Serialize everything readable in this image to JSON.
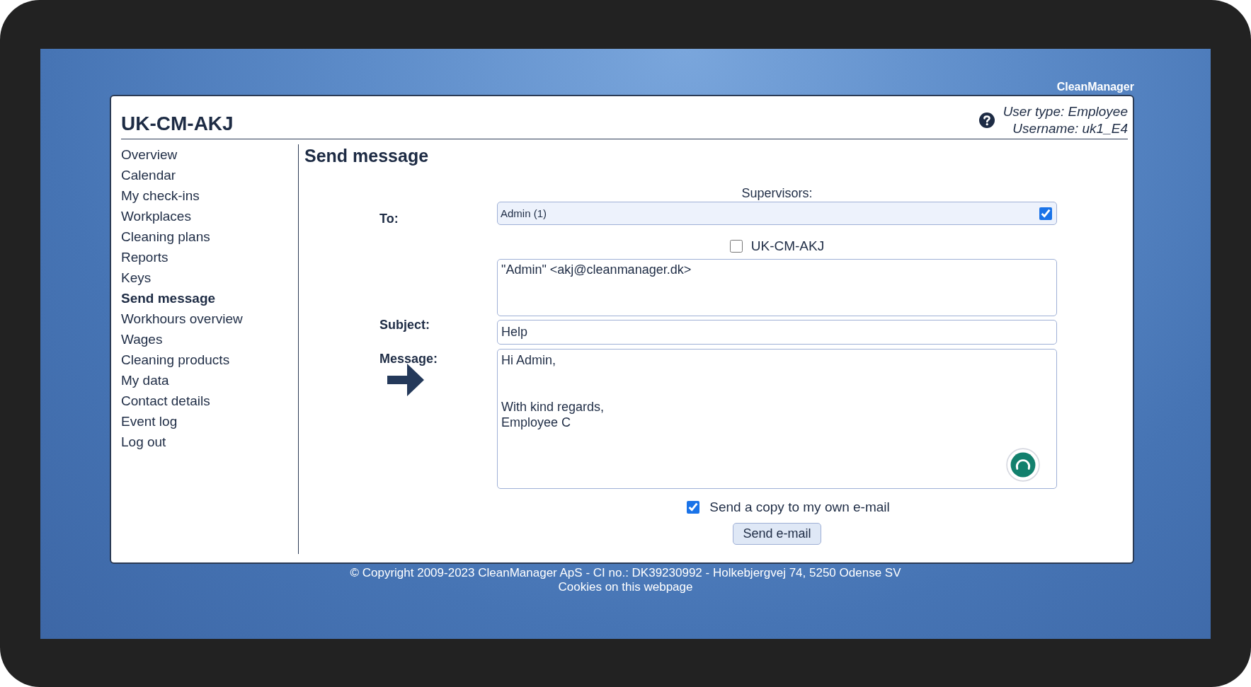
{
  "brand": "CleanManager",
  "header": {
    "title": "UK-CM-AKJ",
    "user_type": "User type: Employee",
    "username": "Username: uk1_E4"
  },
  "sidebar": {
    "items": [
      {
        "label": "Overview",
        "selected": false
      },
      {
        "label": "Calendar",
        "selected": false
      },
      {
        "label": "My check-ins",
        "selected": false
      },
      {
        "label": "Workplaces",
        "selected": false
      },
      {
        "label": "Cleaning plans",
        "selected": false
      },
      {
        "label": "Reports",
        "selected": false
      },
      {
        "label": "Keys",
        "selected": false
      },
      {
        "label": "Send message",
        "selected": true
      },
      {
        "label": "Workhours overview",
        "selected": false
      },
      {
        "label": "Wages",
        "selected": false
      },
      {
        "label": "Cleaning products",
        "selected": false
      },
      {
        "label": "My data",
        "selected": false
      },
      {
        "label": "Contact details",
        "selected": false
      },
      {
        "label": "Event log",
        "selected": false
      },
      {
        "label": "Log out",
        "selected": false
      }
    ]
  },
  "page_title": "Send message",
  "form": {
    "to_label": "To:",
    "group_label": "Supervisors:",
    "recipients": [
      {
        "label": "Admin (1)",
        "checked": true
      }
    ],
    "group_option": {
      "label": "UK-CM-AKJ",
      "checked": false
    },
    "address_list": "\"Admin\" <akj@cleanmanager.dk>",
    "subject_label": "Subject:",
    "subject": "Help",
    "message_label": "Message:",
    "message": "Hi Admin,\n\n\nWith kind regards,\nEmployee C",
    "copy_option": {
      "label": "Send a copy to my own e-mail",
      "checked": true
    },
    "send_button": "Send e-mail"
  },
  "footer": {
    "copyright": "© Copyright 2009-2023 CleanManager ApS - CI no.: DK39230992 - Holkebjergvej 74, 5250 Odense SV",
    "cookies_link": "Cookies on this webpage"
  }
}
